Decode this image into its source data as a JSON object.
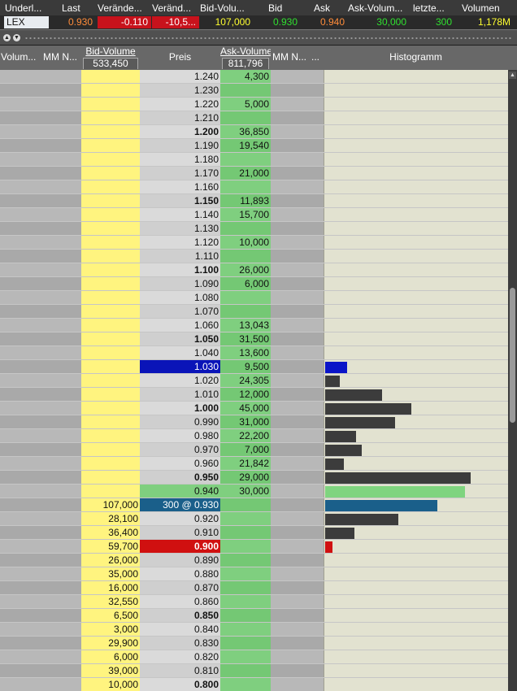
{
  "quote": {
    "headers": [
      "Underl...",
      "Last",
      "Verände...",
      "Veränd...",
      "Bid-Volu...",
      "Bid",
      "Ask",
      "Ask-Volum...",
      "letzte...",
      "Volumen"
    ],
    "values": [
      "LEX",
      "0.930",
      "-0.110",
      "-10,5...",
      "107,000",
      "0.930",
      "0.940",
      "30,000",
      "300",
      "1,178M"
    ],
    "colors": {
      "last": "#ff8c3a",
      "change": "#ffffff",
      "change_bg": "#c8121c",
      "bid_volume": "#ffff30",
      "bid": "#30e030",
      "ask": "#ff8c3a",
      "ask_volume": "#30e030",
      "last_trade": "#30e030",
      "volume": "#ffff30"
    }
  },
  "splitter": {
    "up_icon": "▲",
    "down_icon": "▼"
  },
  "columns": {
    "volume_mm": "Volum...",
    "mm_n_left": "MM N...",
    "bid_volume": "Bid-Volume",
    "bid_volume_total": "533,450",
    "price": "Preis",
    "ask_volume": "Ask-Volume",
    "ask_volume_total": "811,796",
    "mm_n_right": "MM N...",
    "more": "...",
    "histogram": "Histogramm"
  },
  "rows": [
    {
      "price": "1.240",
      "ask": "4,300"
    },
    {
      "price": "1.230"
    },
    {
      "price": "1.220",
      "ask": "5,000"
    },
    {
      "price": "1.210"
    },
    {
      "price": "1.200",
      "ask": "36,850",
      "bold": true
    },
    {
      "price": "1.190",
      "ask": "19,540"
    },
    {
      "price": "1.180"
    },
    {
      "price": "1.170",
      "ask": "21,000"
    },
    {
      "price": "1.160"
    },
    {
      "price": "1.150",
      "ask": "11,893",
      "bold": true
    },
    {
      "price": "1.140",
      "ask": "15,700"
    },
    {
      "price": "1.130"
    },
    {
      "price": "1.120",
      "ask": "10,000"
    },
    {
      "price": "1.110"
    },
    {
      "price": "1.100",
      "ask": "26,000",
      "bold": true
    },
    {
      "price": "1.090",
      "ask": "6,000"
    },
    {
      "price": "1.080"
    },
    {
      "price": "1.070"
    },
    {
      "price": "1.060",
      "ask": "13,043"
    },
    {
      "price": "1.050",
      "ask": "31,500",
      "bold": true
    },
    {
      "price": "1.040",
      "ask": "13,600"
    },
    {
      "price": "1.030",
      "ask": "9,500",
      "highlight": "blue",
      "histogram": 0.12,
      "bar_color": "#0a14c8"
    },
    {
      "price": "1.020",
      "ask": "24,305",
      "histogram": 0.08,
      "bar_color": "#3c3c3c"
    },
    {
      "price": "1.010",
      "ask": "12,000",
      "histogram": 0.31,
      "bar_color": "#3c3c3c"
    },
    {
      "price": "1.000",
      "ask": "45,000",
      "bold": true,
      "histogram": 0.47,
      "bar_color": "#3c3c3c"
    },
    {
      "price": "0.990",
      "ask": "31,000",
      "histogram": 0.38,
      "bar_color": "#3c3c3c"
    },
    {
      "price": "0.980",
      "ask": "22,200",
      "histogram": 0.17,
      "bar_color": "#3c3c3c"
    },
    {
      "price": "0.970",
      "ask": "7,000",
      "histogram": 0.2,
      "bar_color": "#3c3c3c"
    },
    {
      "price": "0.960",
      "ask": "21,842",
      "histogram": 0.1,
      "bar_color": "#3c3c3c"
    },
    {
      "price": "0.950",
      "ask": "29,000",
      "bold": true,
      "histogram": 0.79,
      "bar_color": "#3c3c3c"
    },
    {
      "price": "0.940",
      "ask": "30,000",
      "highlight": "green",
      "histogram": 0.76,
      "bar_color": "#7fd47f"
    },
    {
      "price": "300 @ 0.930",
      "bid": "107,000",
      "highlight": "teal",
      "histogram": 0.61,
      "bar_color": "#1a5f8a"
    },
    {
      "price": "0.920",
      "bid": "28,100",
      "histogram": 0.4,
      "bar_color": "#3c3c3c"
    },
    {
      "price": "0.910",
      "bid": "36,400",
      "histogram": 0.16,
      "bar_color": "#3c3c3c"
    },
    {
      "price": "0.900",
      "bid": "59,700",
      "bold": true,
      "highlight": "red",
      "histogram": 0.04,
      "bar_color": "#d01010"
    },
    {
      "price": "0.890",
      "bid": "26,000"
    },
    {
      "price": "0.880",
      "bid": "35,000"
    },
    {
      "price": "0.870",
      "bid": "16,000"
    },
    {
      "price": "0.860",
      "bid": "32,550"
    },
    {
      "price": "0.850",
      "bid": "6,500",
      "bold": true
    },
    {
      "price": "0.840",
      "bid": "3,000"
    },
    {
      "price": "0.830",
      "bid": "29,900"
    },
    {
      "price": "0.820",
      "bid": "6,000"
    },
    {
      "price": "0.810",
      "bid": "39,000"
    },
    {
      "price": "0.800",
      "bid": "10,000",
      "bold": true
    }
  ]
}
